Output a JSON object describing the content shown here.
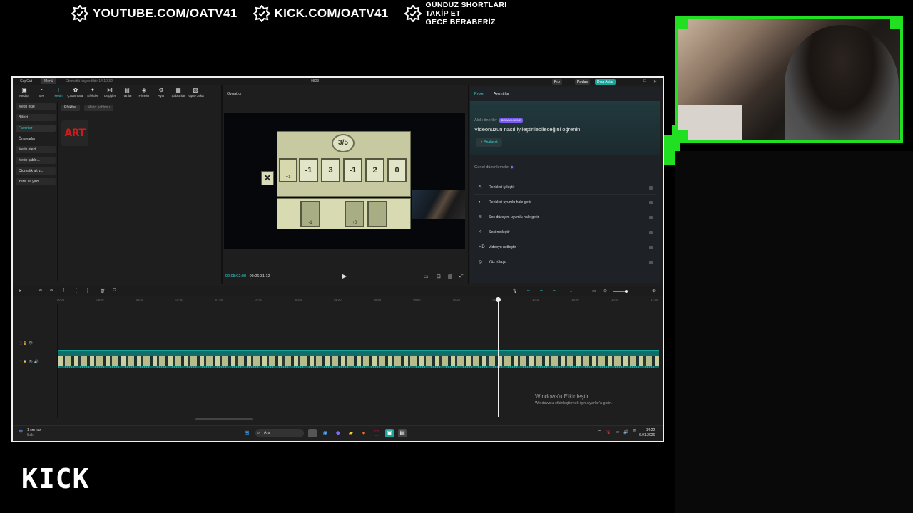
{
  "overlay": {
    "youtube": "YOUTUBE.COM/OATV41",
    "kick": "KICK.COM/OATV41",
    "promo_lines": [
      "GÜNDÜZ SHORTLARI",
      "TAKİP ET",
      "GECE BERABERİZ"
    ],
    "kick_logo": "KICK",
    "accent_color": "#21e021"
  },
  "app": {
    "name": "CapCut",
    "menu": "Menü",
    "autosave": "Otomatik kaydedildi: 14:19:32",
    "project_name": "0823",
    "pro_label": "Pro",
    "share_label": "Paylaş",
    "export_label": "Dışa Aktar"
  },
  "toolbar": [
    {
      "icon": "media-icon",
      "glyph": "▣",
      "label": "Medya"
    },
    {
      "icon": "audio-icon",
      "glyph": "◔",
      "label": "Ses"
    },
    {
      "icon": "text-icon",
      "glyph": "T",
      "label": "Metin",
      "active": true
    },
    {
      "icon": "stickers-icon",
      "glyph": "✿",
      "label": "Çıkartmalar"
    },
    {
      "icon": "effects-icon",
      "glyph": "✦",
      "label": "Efektler"
    },
    {
      "icon": "transitions-icon",
      "glyph": "⋈",
      "label": "Geçişler"
    },
    {
      "icon": "captions-icon",
      "glyph": "▤",
      "label": "Yazılar"
    },
    {
      "icon": "filters-icon",
      "glyph": "◈",
      "label": "Filtreler"
    },
    {
      "icon": "adjust-icon",
      "glyph": "⚙",
      "label": "Ayar"
    },
    {
      "icon": "templates-icon",
      "glyph": "▦",
      "label": "Şablonlar"
    },
    {
      "icon": "ai-icon",
      "glyph": "▧",
      "label": "Yapay zekâ"
    }
  ],
  "leftnav": [
    {
      "label": "Metin ekle",
      "style": "bg"
    },
    {
      "label": "Bilinki",
      "style": "bg"
    },
    {
      "label": "Favoriler",
      "style": "sel"
    },
    {
      "label": "Ön ayarlar",
      "style": ""
    },
    {
      "label": "Metin efekt...",
      "style": "bg"
    },
    {
      "label": "Metin şablo...",
      "style": "bg"
    },
    {
      "label": "Otomatik alt y...",
      "style": "bg"
    },
    {
      "label": "Yerel alt yazı",
      "style": "bg"
    }
  ],
  "effects_tabs": [
    "Efektler",
    "Metin şablonu"
  ],
  "art_thumb": "ART",
  "player": {
    "title": "Oynatıcı",
    "current_time": "00:08:02:08",
    "total_time": "00:26:31:12",
    "game": {
      "counter": "3/5",
      "slot": "+1",
      "cards": [
        "-1",
        "3",
        "-1",
        "2",
        "0"
      ],
      "buttons": [
        "-1",
        "+0"
      ]
    }
  },
  "right_panel": {
    "tabs": [
      "Proje",
      "Ayrıntılar"
    ],
    "ai_label": "Akıllı öneriler",
    "ai_badge": "BEDAVA DENE",
    "ai_title": "Videonuzun nasıl iyileştirilebileceğini öğrenin",
    "analyze": "Analiz et",
    "general_label": "Genel düzenlemeler",
    "options": [
      {
        "icon": "color-wand-icon",
        "glyph": "✎",
        "label": "Renkleri iyileştir"
      },
      {
        "icon": "color-match-icon",
        "glyph": "◐",
        "label": "Renkleri uyumlu hale getir"
      },
      {
        "icon": "volume-normalize-icon",
        "glyph": "≋",
        "label": "Ses düzeyini uyumlu hale getir"
      },
      {
        "icon": "audio-enhance-icon",
        "glyph": "✧",
        "label": "Sesi netleştir"
      },
      {
        "icon": "hd-icon",
        "glyph": "HD",
        "label": "Videoyu netleştir"
      },
      {
        "icon": "face-retouch-icon",
        "glyph": "◎",
        "label": "Yüz rötuşu"
      }
    ]
  },
  "timeline": {
    "ruler": [
      "00:00",
      "06:20",
      "06:40",
      "07:00",
      "07:20",
      "07:40",
      "08:00",
      "08:20",
      "08:40",
      "09:00",
      "09:20",
      "09:40",
      "10:00",
      "10:20",
      "10:40",
      "11:00"
    ]
  },
  "windows": {
    "activate_title": "Windows'u Etkinleştir",
    "activate_sub": "Windows'u etkinleştirmek için Ayarlar'a gidin.",
    "weather_temp": "1 cm kar",
    "weather_day": "Salı",
    "search": "Ara",
    "time": "14:22",
    "date": "6.01.2026"
  }
}
